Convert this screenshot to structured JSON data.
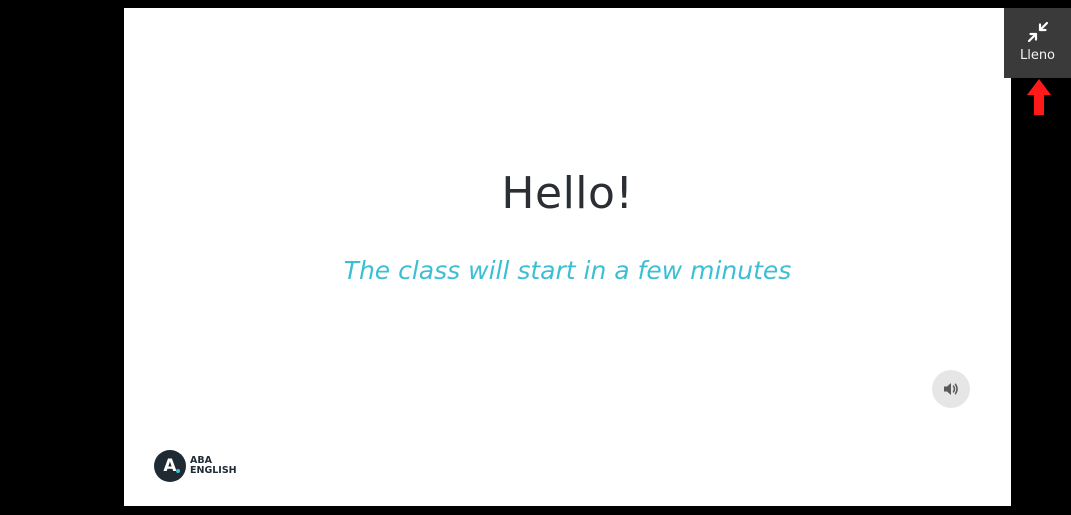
{
  "slide": {
    "title": "Hello!",
    "subtitle": "The class will start in a few minutes",
    "sound_icon": "speaker-volume-icon",
    "logo": {
      "mark_letter": "A",
      "line1": "ABA",
      "line2": "ENGLISH"
    }
  },
  "fullscreen": {
    "icon": "exit-fullscreen-icon",
    "label": "Lleno"
  },
  "annotation": {
    "icon": "red-up-arrow-icon",
    "color": "#ff1a1a"
  },
  "colors": {
    "background": "#000000",
    "slide": "#ffffff",
    "title": "#2b2f33",
    "subtitle": "#3dbfd3",
    "panel": "#3a3a3a"
  }
}
